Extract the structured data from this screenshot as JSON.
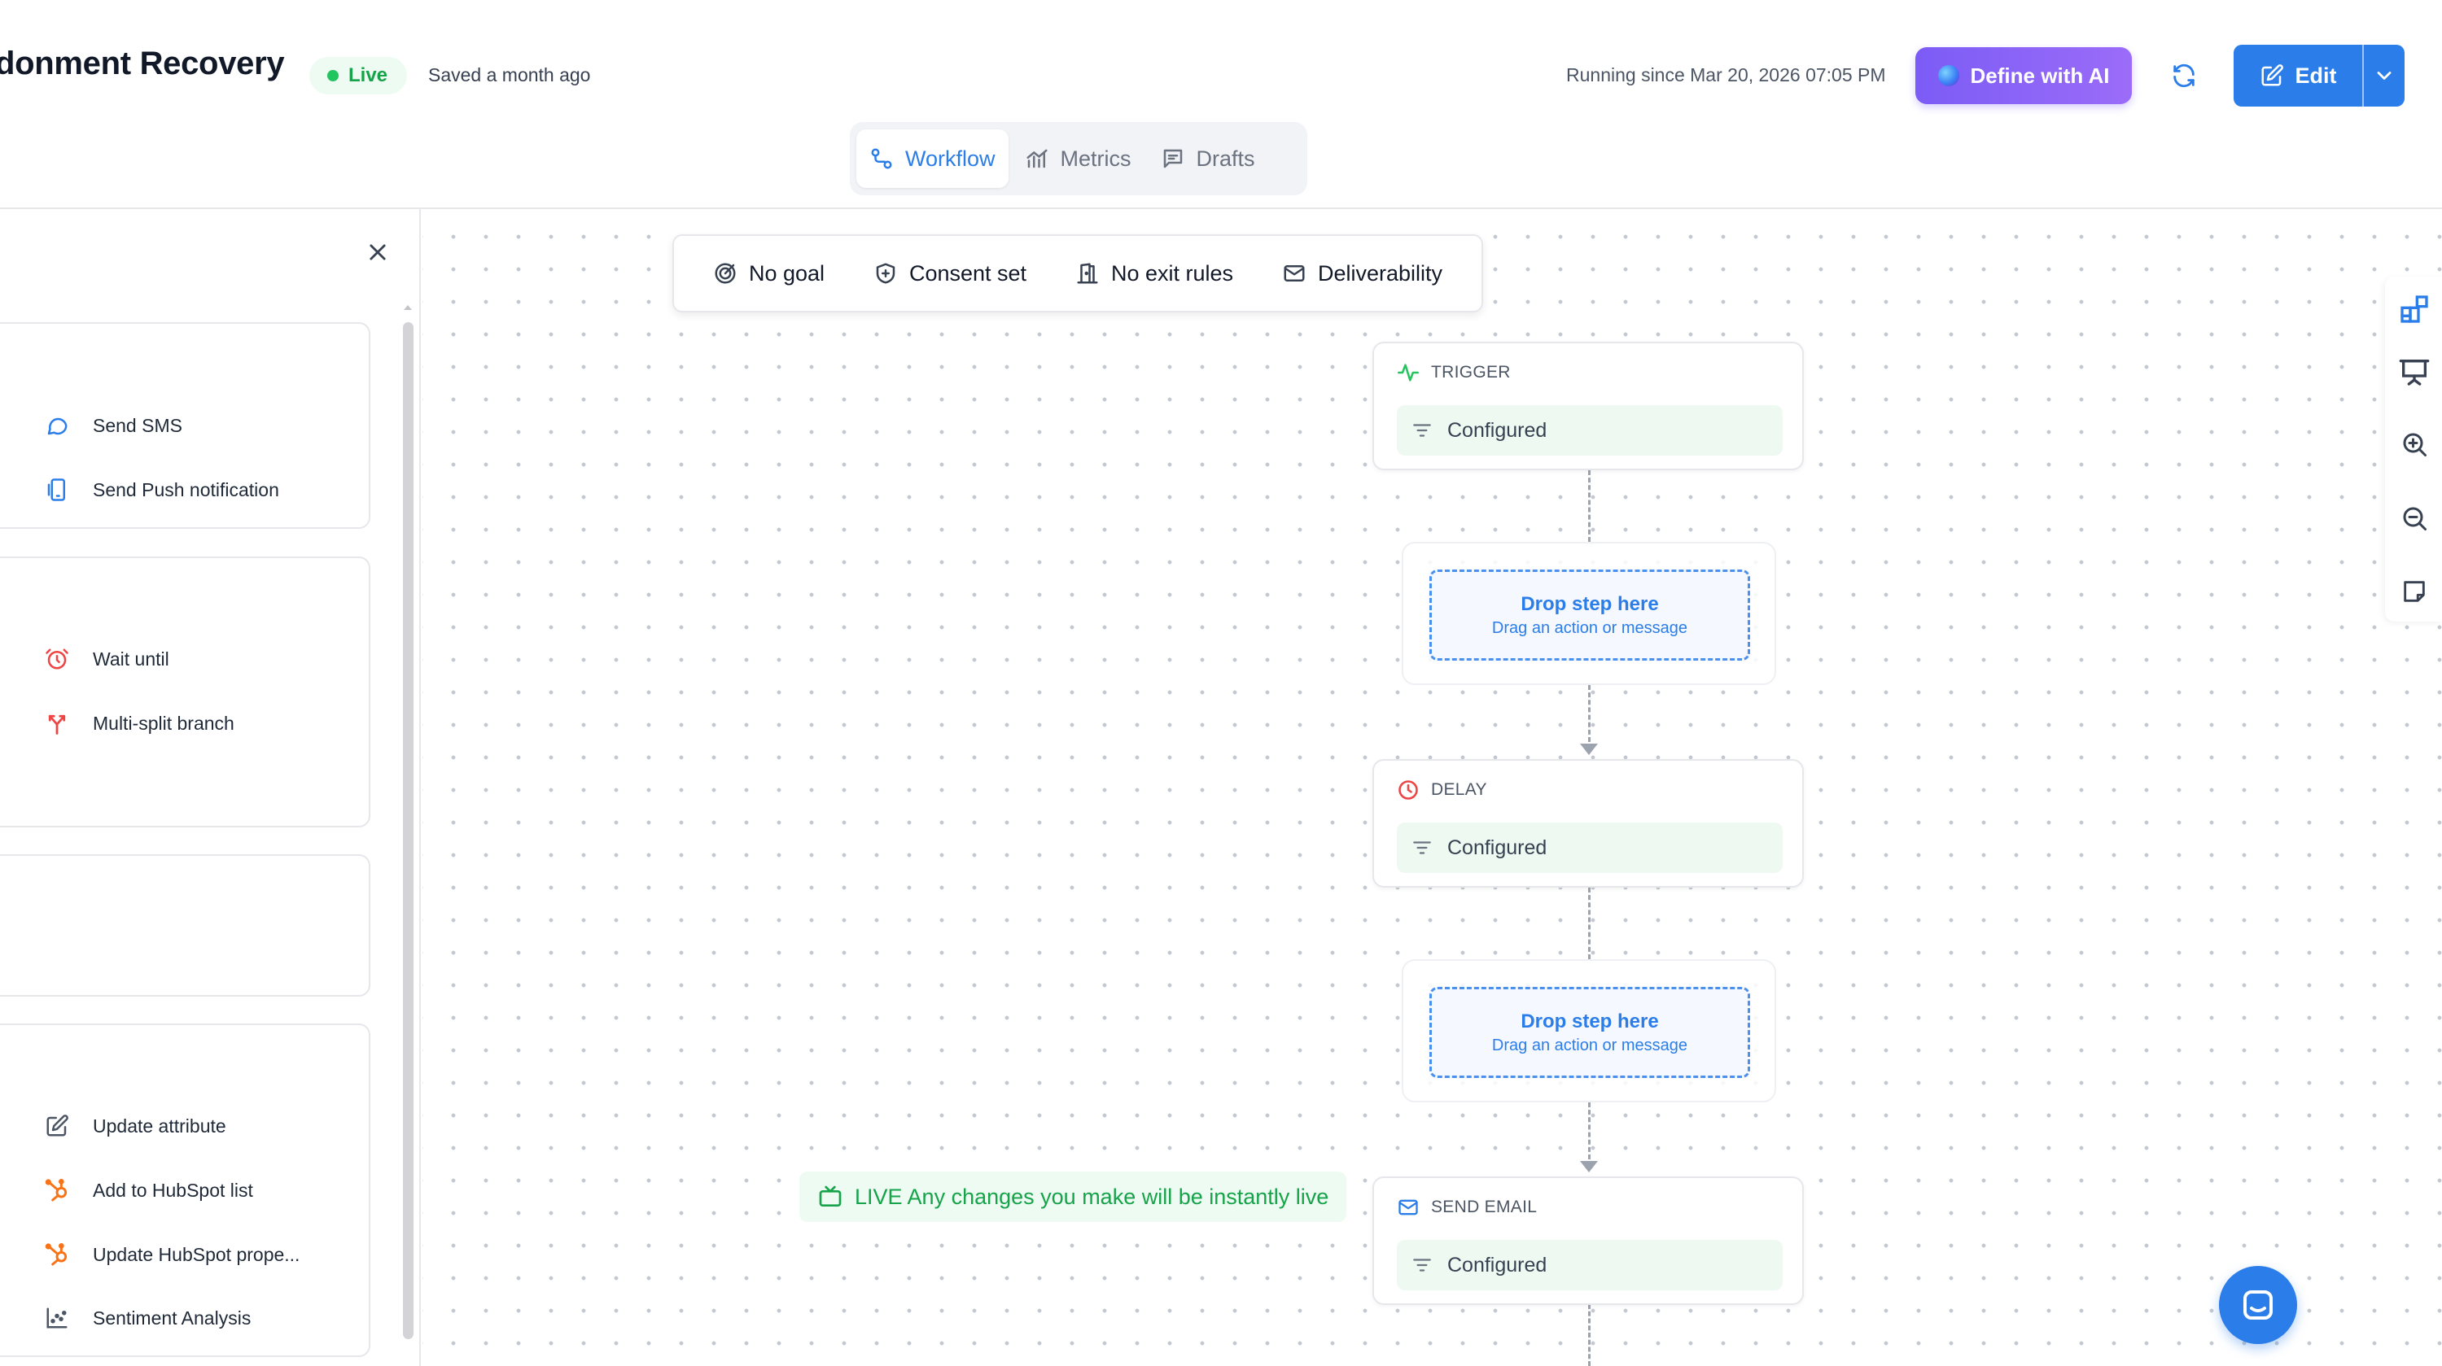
{
  "header": {
    "title": "donment Recovery",
    "status_badge": "Live",
    "saved_text": "Saved a month ago",
    "running_text": "Running since Mar 20, 2026 07:05 PM",
    "define_ai_label": "Define with AI",
    "edit_label": "Edit",
    "colors": {
      "primary": "#2b7de9",
      "ai_gradient_start": "#7c5cf6",
      "live": "#16a34a"
    }
  },
  "tabs": [
    {
      "label": "Workflow",
      "icon": "workflow-icon",
      "active": true
    },
    {
      "label": "Metrics",
      "icon": "chart-icon",
      "active": false
    },
    {
      "label": "Drafts",
      "icon": "drafts-icon",
      "active": false
    }
  ],
  "sidebar": {
    "items": [
      {
        "label": "Send SMS",
        "icon": "chat-bubble-icon"
      },
      {
        "label": "Send Push notification",
        "icon": "mobile-push-icon"
      },
      {
        "label": "Wait until",
        "icon": "alarm-clock-icon"
      },
      {
        "label": "Multi-split branch",
        "icon": "split-branch-icon"
      },
      {
        "label": "Update attribute",
        "icon": "edit-square-icon"
      },
      {
        "label": "Add to HubSpot list",
        "icon": "hubspot-icon"
      },
      {
        "label": "Update HubSpot prope...",
        "icon": "hubspot-icon"
      },
      {
        "label": "Sentiment Analysis",
        "icon": "scatter-chart-icon"
      }
    ]
  },
  "toolbar": {
    "items": [
      {
        "label": "No goal",
        "icon": "goal-icon"
      },
      {
        "label": "Consent set",
        "icon": "shield-icon"
      },
      {
        "label": "No exit rules",
        "icon": "exit-door-icon"
      },
      {
        "label": "Deliverability",
        "icon": "mail-icon"
      }
    ]
  },
  "nodes": [
    {
      "type": "TRIGGER",
      "status": "Configured",
      "icon": "activity-icon"
    },
    {
      "type": "DELAY",
      "status": "Configured",
      "icon": "clock-icon"
    },
    {
      "type": "SEND EMAIL",
      "status": "Configured",
      "icon": "mail-icon"
    }
  ],
  "drop_zones": [
    {
      "title": "Drop step here",
      "subtitle": "Drag an action or message"
    },
    {
      "title": "Drop step here",
      "subtitle": "Drag an action or message"
    }
  ],
  "live_notice": "LIVE Any changes you make will be instantly live",
  "canvas_tools": [
    "add-widget-icon",
    "presentation-icon",
    "zoom-in-icon",
    "zoom-out-icon",
    "note-icon"
  ]
}
